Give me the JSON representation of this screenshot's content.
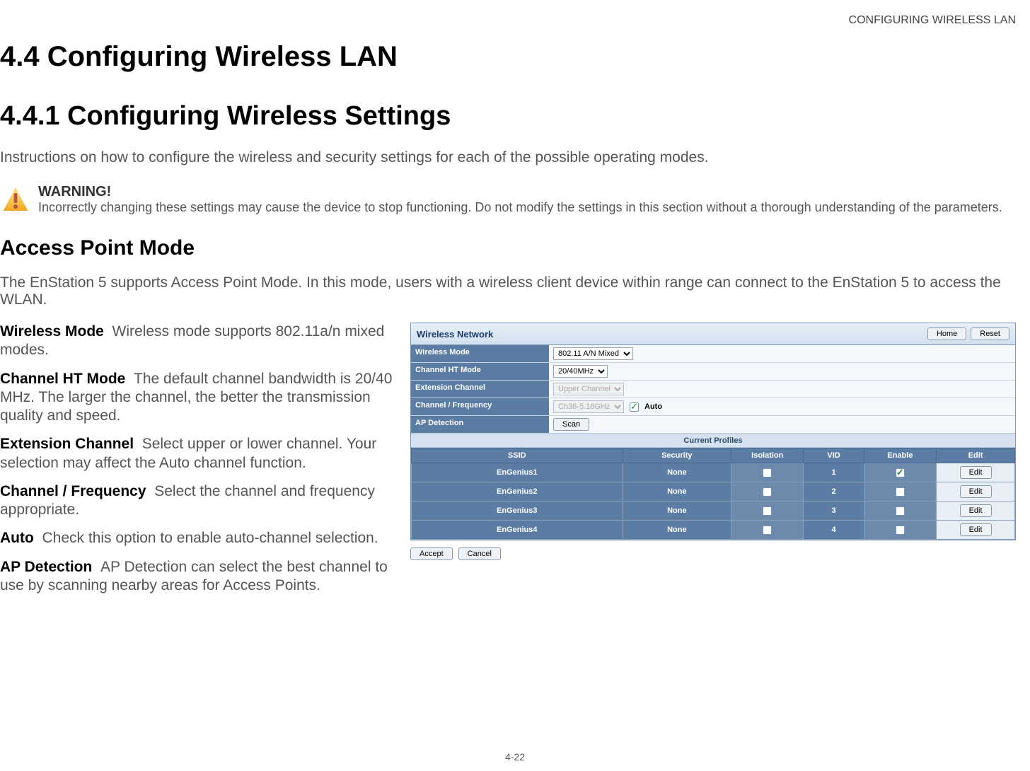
{
  "header": {
    "running_head": "CONFIGURING WIRELESS LAN"
  },
  "section": {
    "number_title": "4.4 Configuring Wireless LAN",
    "sub_number_title": "4.4.1 Configuring Wireless Settings",
    "intro": "Instructions on how to configure the wireless and security settings for each of the possible operating modes."
  },
  "warning": {
    "label": "WARNING!",
    "text": "Incorrectly changing these settings may cause the device to stop functioning. Do not modify the settings in this section without a thorough understanding of the parameters."
  },
  "mode": {
    "heading": "Access Point Mode",
    "intro": "The EnStation 5 supports Access Point Mode. In this mode, users with a wireless client device within range can connect to the EnStation 5 to access the WLAN."
  },
  "definitions": [
    {
      "term": "Wireless Mode",
      "desc": "Wireless mode supports 802.11a/n mixed modes."
    },
    {
      "term": "Channel HT Mode",
      "desc": "The default channel bandwidth is 20/40 MHz. The larger the channel, the better the transmission quality and speed."
    },
    {
      "term": "Extension Channel",
      "desc": "Select upper or lower channel. Your selection may affect the Auto channel function."
    },
    {
      "term": "Channel / Frequency",
      "desc": "Select the channel and frequency appropriate."
    },
    {
      "term": "Auto",
      "desc": "Check this option to enable auto-channel selection."
    },
    {
      "term": "AP Detection",
      "desc": "AP Detection can select the best channel to use by scanning nearby areas for Access Points."
    }
  ],
  "ui": {
    "panel_title": "Wireless Network",
    "home": "Home",
    "reset": "Reset",
    "rows": {
      "wireless_mode": {
        "label": "Wireless Mode",
        "value": "802.11 A/N Mixed"
      },
      "channel_ht": {
        "label": "Channel HT Mode",
        "value": "20/40MHz"
      },
      "extension": {
        "label": "Extension Channel",
        "value": "Upper Channel"
      },
      "channel_freq": {
        "label": "Channel / Frequency",
        "value": "Ch36-5.18GHz",
        "auto_label": "Auto"
      },
      "ap_detection": {
        "label": "AP Detection",
        "scan": "Scan"
      }
    },
    "profiles_title": "Current Profiles",
    "profile_headers": {
      "ssid": "SSID",
      "security": "Security",
      "isolation": "Isolation",
      "vid": "VID",
      "enable": "Enable",
      "edit": "Edit"
    },
    "profiles": [
      {
        "ssid": "EnGenius1",
        "security": "None",
        "isolation": false,
        "vid": "1",
        "enable": true,
        "edit": "Edit"
      },
      {
        "ssid": "EnGenius2",
        "security": "None",
        "isolation": false,
        "vid": "2",
        "enable": false,
        "edit": "Edit"
      },
      {
        "ssid": "EnGenius3",
        "security": "None",
        "isolation": false,
        "vid": "3",
        "enable": false,
        "edit": "Edit"
      },
      {
        "ssid": "EnGenius4",
        "security": "None",
        "isolation": false,
        "vid": "4",
        "enable": false,
        "edit": "Edit"
      }
    ],
    "accept": "Accept",
    "cancel": "Cancel"
  },
  "page_number": "4-22"
}
